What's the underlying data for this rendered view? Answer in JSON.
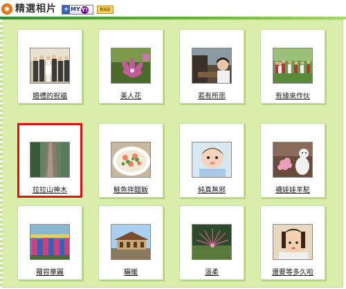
{
  "header": {
    "title": "精選相片",
    "myyahoo_label": "MY",
    "myyahoo_logo": "Y!",
    "rss_label": "RSS"
  },
  "colors": {
    "accent": "#f07a1a",
    "panel": "#d8eeaa",
    "selected_border": "#e01010"
  },
  "photos": [
    {
      "caption": "婚禮的祝福",
      "icon": "wedding-group-photo"
    },
    {
      "caption": "美人花",
      "icon": "pink-flower-photo"
    },
    {
      "caption": "若有所思",
      "icon": "thinking-person-photo"
    },
    {
      "caption": "有緣來作伙",
      "icon": "group-gathering-photo"
    },
    {
      "caption": "拉拉山神木",
      "icon": "giant-tree-photo",
      "selected": true
    },
    {
      "caption": "鮭魚拌醋飯",
      "icon": "salmon-rice-photo"
    },
    {
      "caption": "純真無邪",
      "icon": "baby-photo"
    },
    {
      "caption": "襪娃娃羊駝",
      "icon": "sock-doll-alpaca-photo"
    },
    {
      "caption": "羅容華麗",
      "icon": "dancers-photo"
    },
    {
      "caption": "曬暖",
      "icon": "house-sunbathing-photo"
    },
    {
      "caption": "溫柔",
      "icon": "soft-bloom-photo"
    },
    {
      "caption": "還要等多久啦",
      "icon": "waiting-child-photo"
    }
  ]
}
